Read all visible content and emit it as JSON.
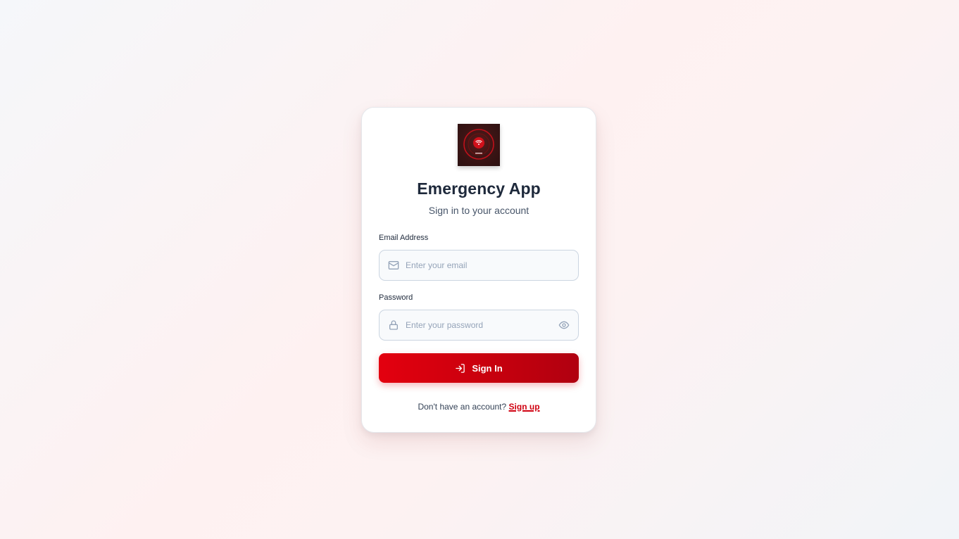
{
  "app": {
    "title": "Emergency App",
    "subtitle": "Sign in to your account",
    "logo_icon": "emergency-wifi-logo"
  },
  "form": {
    "email_label": "Email Address",
    "email_placeholder": "Enter your email",
    "email_value": "",
    "email_icon": "mail-icon",
    "password_label": "Password",
    "password_placeholder": "Enter your password",
    "password_value": "",
    "password_icon": "lock-icon",
    "toggle_icon": "eye-icon",
    "submit_label": "Sign In",
    "submit_icon": "sign-in-icon"
  },
  "footer": {
    "prompt": "Don't have an account?",
    "link_label": "Sign up"
  },
  "colors": {
    "accent": "#e3000f",
    "text": "#1e293b"
  }
}
